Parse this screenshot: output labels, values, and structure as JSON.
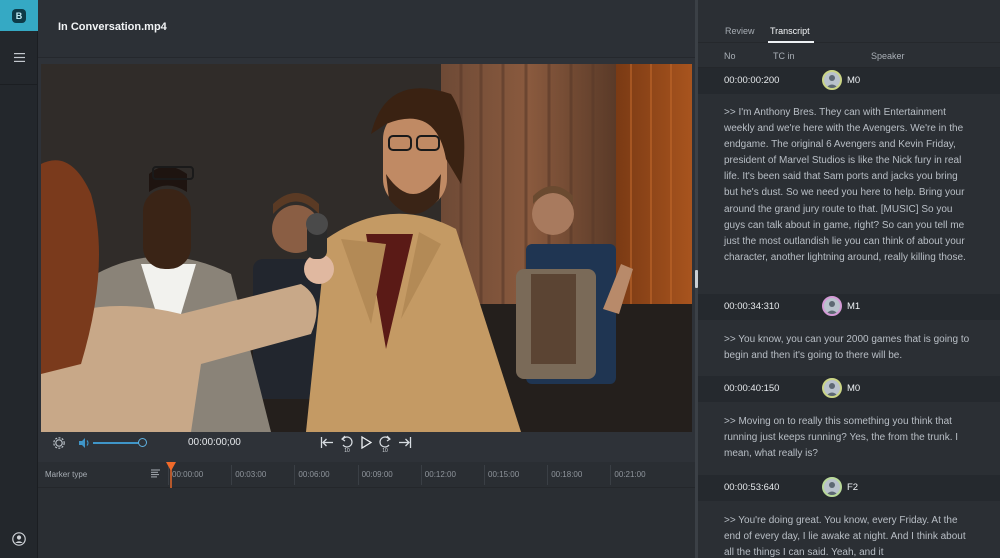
{
  "header": {
    "file_title": "In Conversation.mp4"
  },
  "player": {
    "timecode": "00:00:00;00",
    "volume": 0.8,
    "controls": [
      "settings-icon",
      "volume-icon",
      "jump-start-icon",
      "rewind-10-icon",
      "play-icon",
      "forward-10-icon",
      "jump-end-icon"
    ],
    "skip_label": "10"
  },
  "timeline": {
    "marker_type_label": "Marker type",
    "ticks": [
      "00:00:00",
      "00:03:00",
      "00:06:00",
      "00:09:00",
      "00:12:00",
      "00:15:00",
      "00:18:00",
      "00:21:00"
    ]
  },
  "panel": {
    "tabs": [
      "Review",
      "Transcript"
    ],
    "active_tab": "Transcript",
    "columns": [
      "No",
      "TC in",
      "Speaker"
    ],
    "entries": [
      {
        "tc": "00:00:00:200",
        "speaker": "M0",
        "text": ">> I'm Anthony Bres. They can with Entertainment weekly and we're here with the Avengers. We're in the endgame. The original 6 Avengers and Kevin Friday, president of Marvel Studios is like the Nick fury in real life. It's been said that Sam ports and jacks you bring but he's dust. So we need you here to help. Bring your around the grand jury route to that. [MUSIC] So you guys can talk about in game, right? So can you tell me just the most outlandish lie you can think of about your character, another lightning around, really killing those."
      },
      {
        "tc": "00:00:34:310",
        "speaker": "M1",
        "text": ">> You know, you can your 2000 games that is going to begin and then it's going to there will be."
      },
      {
        "tc": "00:00:40:150",
        "speaker": "M0",
        "text": ">> Moving on to really this something you think that running just keeps running? Yes, the from the trunk. I mean, what really is?"
      },
      {
        "tc": "00:00:53:640",
        "speaker": "F2",
        "text": ">> You're doing great. You know, every Friday. At the end of every day, I lie awake at night. And I think about all the things I can said. Yeah, and it"
      }
    ]
  },
  "colors": {
    "accent": "#35a9c4",
    "volume": "#3f95c8",
    "playhead": "#f06a2a"
  }
}
